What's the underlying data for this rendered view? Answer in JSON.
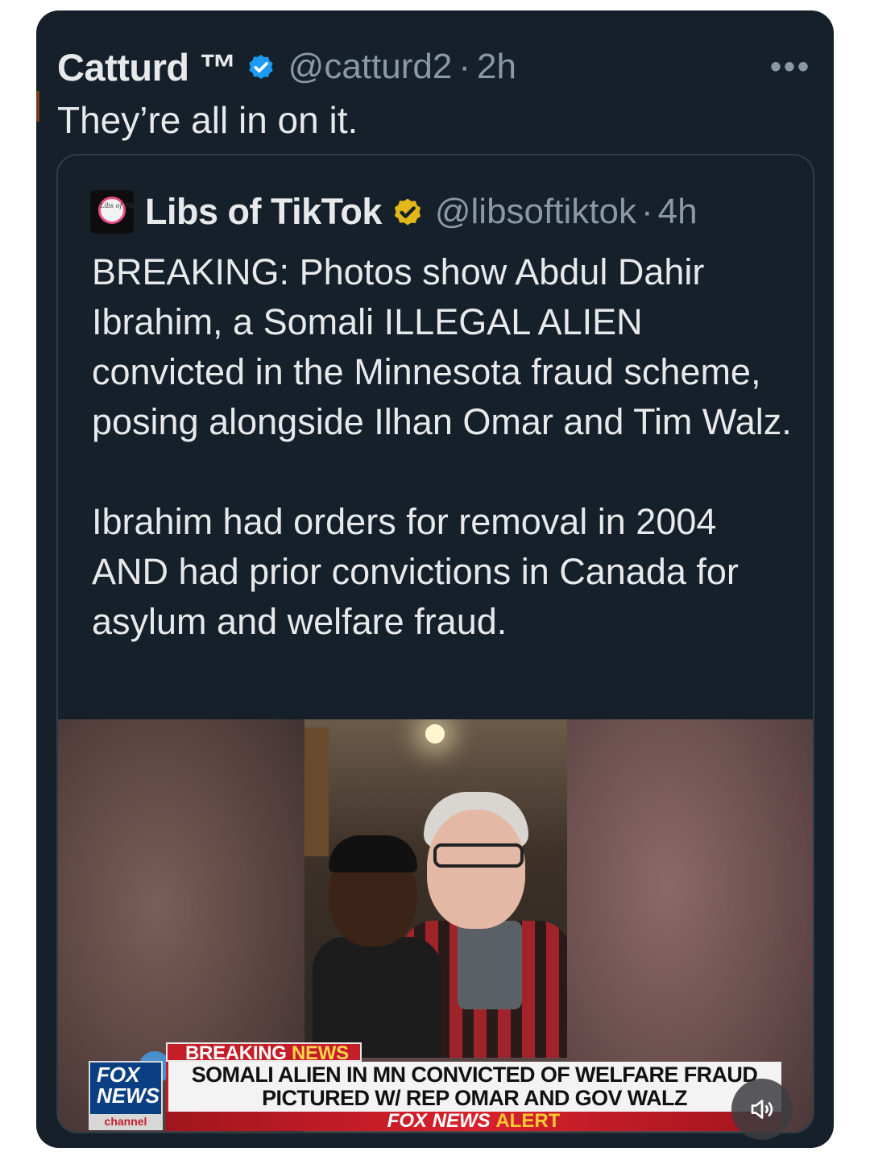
{
  "tweet": {
    "author_name": "Catturd ™",
    "handle": "@catturd2",
    "time": "2h",
    "text": "They’re all in on it.",
    "more_label": "•••"
  },
  "quoted_tweet": {
    "avatar_text": "Libs of TikTok",
    "author_name": "Libs of TikTok",
    "handle": "@libsoftiktok",
    "time": "4h",
    "paragraph1": "BREAKING: Photos show Abdul Dahir Ibrahim, a Somali ILLEGAL ALIEN convicted in the Minnesota fraud scheme, posing alongside Ilhan Omar and Tim Walz.",
    "paragraph2": "Ibrahim had orders for removal in 2004 AND had prior convictions in Canada for asylum and welfare fraud."
  },
  "media": {
    "ticker_title_part1": "BREAKING ",
    "ticker_title_part2": "NEWS",
    "ticker_line1": "SOMALI ALIEN IN MN CONVICTED OF WELFARE FRAUD",
    "ticker_line2": "PICTURED W/ REP OMAR AND GOV WALZ",
    "ticker_bottom_part1": "FOX NEWS ",
    "ticker_bottom_part2": "ALERT",
    "logo_line1": "FOX",
    "logo_line2": "NEWS",
    "logo_line3": "channel"
  },
  "colors": {
    "background": "#15202b",
    "text_primary": "#e7e9ea",
    "text_secondary": "#8b98a5",
    "verified_blue": "#1d9bf0",
    "verified_gold": "#e2b719",
    "fox_red": "#c41f28"
  },
  "icons": [
    "verified-badge-blue-icon",
    "verified-badge-gold-icon",
    "more-options-icon",
    "sound-icon"
  ]
}
